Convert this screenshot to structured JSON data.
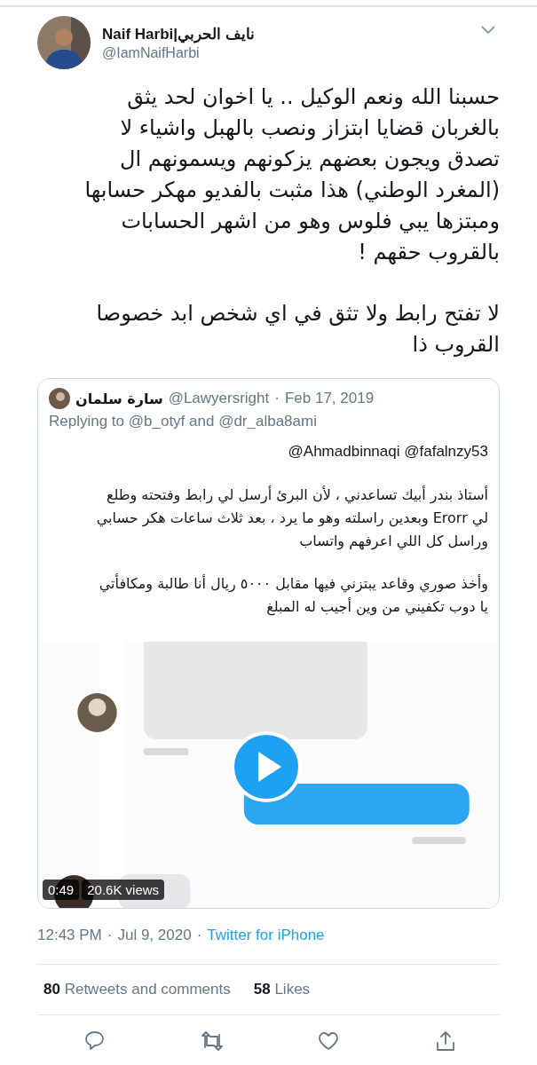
{
  "tweet": {
    "author": {
      "name": "Naif Harbi|نايف الحربي",
      "handle": "@IamNaifHarbi"
    },
    "paragraphs": [
      "حسبنا الله ونعم الوكيل .. يا اخوان لحد يثق\nبالغربان قضايا ابتزاز ونصب بالهبل واشياء لا\nتصدق ويجون بعضهم يزكونهم ويسمونهم ال\n(المغرد الوطني) هذا مثبت بالفديو مهكر حسابها\nومبتزها يبي فلوس وهو من اشهر الحسابات\nبالقروب حقهم !",
      "لا تفتح رابط ولا تثق في اي شخص ابد خصوصا\nالقروب ذا"
    ],
    "quoted": {
      "name": "سارة سلمان",
      "handle": "@Lawyersright",
      "separator": "·",
      "date": "Feb 17, 2019",
      "replying_to": "Replying to @b_otyf and @dr_alba8ami",
      "mentions": "@Ahmadbinnaqi @fafalnzy53",
      "paragraphs": [
        "أستاذ بندر أبيك تساعدني ، لأن البرئ أرسل لي رابط وفتحته وطلع\nلي Erorr وبعدين راسلته وهو ما يرد ، بعد ثلاث ساعات هكر حسابي\nوراسل كل اللي اعرفهم واتساب",
        "وأخذ صوري وقاعد يبتزني فيها مقابل ٥٠٠٠ ريال أنا طالبة ومكافأتي\nيا دوب تكفيني من وين أجيب له المبلغ"
      ],
      "video": {
        "kind": "picture",
        "duration": "0:49",
        "views": "20.6K views"
      }
    },
    "time": "12:43 PM",
    "separator_1": "·",
    "date": "Jul 9, 2020",
    "separator_2": "·",
    "source": "Twitter for iPhone",
    "retweets": {
      "count": "80",
      "label": "Retweets and comments"
    },
    "likes": {
      "count": "58",
      "label": "Likes"
    },
    "actions": [
      {
        "kind": "reply"
      },
      {
        "kind": "retweet"
      },
      {
        "kind": "like"
      },
      {
        "kind": "share"
      }
    ]
  }
}
